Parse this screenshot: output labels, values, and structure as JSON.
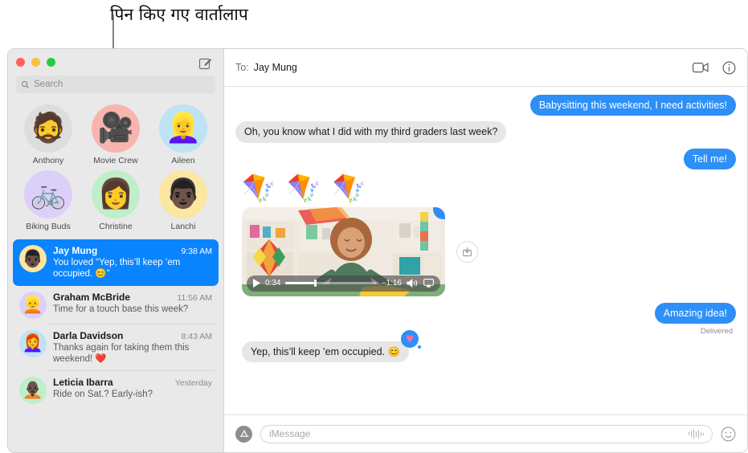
{
  "annotation": {
    "label": "पिन किए गए वार्तालाप"
  },
  "window": {
    "traffic_lights": [
      {
        "name": "close",
        "color": "#ff605c"
      },
      {
        "name": "minimize",
        "color": "#ffbd44"
      },
      {
        "name": "zoom",
        "color": "#28ca41"
      }
    ],
    "compose_icon": "compose-icon"
  },
  "sidebar": {
    "search": {
      "placeholder": "Search",
      "icon": "search-icon"
    },
    "pinned": [
      {
        "name": "Anthony",
        "emoji": "🧔",
        "bg": "#dddddd"
      },
      {
        "name": "Movie Crew",
        "emoji": "🎥",
        "bg": "#f8b4ae"
      },
      {
        "name": "Aileen",
        "emoji": "👱‍♀️",
        "bg": "#bde3f5"
      },
      {
        "name": "Biking Buds",
        "emoji": "🚲",
        "bg": "#dcd0fb"
      },
      {
        "name": "Christine",
        "emoji": "👩",
        "bg": "#bfeeca"
      },
      {
        "name": "Lanchi",
        "emoji": "👨🏿",
        "bg": "#fbe6a2"
      }
    ],
    "conversations": [
      {
        "name": "Jay Mung",
        "time": "9:38 AM",
        "preview": "You loved “Yep, this’ll keep ’em occupied. 😊”",
        "emoji": "👨🏿",
        "bg": "#fbe6a2",
        "selected": true
      },
      {
        "name": "Graham McBride",
        "time": "11:56 AM",
        "preview": "Time for a touch base this week?",
        "emoji": "👱",
        "bg": "#dcd0fb",
        "selected": false
      },
      {
        "name": "Darla Davidson",
        "time": "8:43 AM",
        "preview": "Thanks again for taking them this weekend! ❤️",
        "emoji": "👩‍🦰",
        "bg": "#bde3f5",
        "selected": false
      },
      {
        "name": "Leticia Ibarra",
        "time": "Yesterday",
        "preview": "Ride on Sat.? Early-ish?",
        "emoji": "🧑🏿‍🦲",
        "bg": "#bfeeca",
        "selected": false
      }
    ]
  },
  "chat": {
    "to_label": "To:",
    "to_name": "Jay Mung",
    "facetime_icon": "facetime-video-icon",
    "info_icon": "info-icon",
    "messages": [
      {
        "side": "out",
        "text": "Babysitting this weekend, I need activities!"
      },
      {
        "side": "in",
        "text": "Oh, you know what I did with my third graders last week?"
      },
      {
        "side": "out",
        "text": "Tell me!"
      }
    ],
    "kites": "🪁🪁🪁",
    "video": {
      "elapsed": "0:34",
      "remaining": "–1:16",
      "play_icon": "play-icon",
      "volume_icon": "volume-icon",
      "airplay_icon": "airplay-icon",
      "progress_percent": 31,
      "tapback": "♥",
      "share_icon": "share-download-icon"
    },
    "reply": {
      "text": "Amazing idea!",
      "status": "Delivered"
    },
    "last_incoming": {
      "text": "Yep, this’ll keep ’em occupied. 😊",
      "tapback": "♥"
    }
  },
  "composer": {
    "apps_icon": "app-store-icon",
    "placeholder": "iMessage",
    "audio_icon": "audio-waveform-icon",
    "emoji_icon": "emoji-smiley-icon"
  },
  "colors": {
    "accent_blue": "#2e8ff7",
    "selected_blue": "#0a84ff",
    "incoming_gray": "#e6e6e6",
    "sidebar_bg": "#e9e9e9",
    "tapback_heart": "#ff6b9d"
  }
}
